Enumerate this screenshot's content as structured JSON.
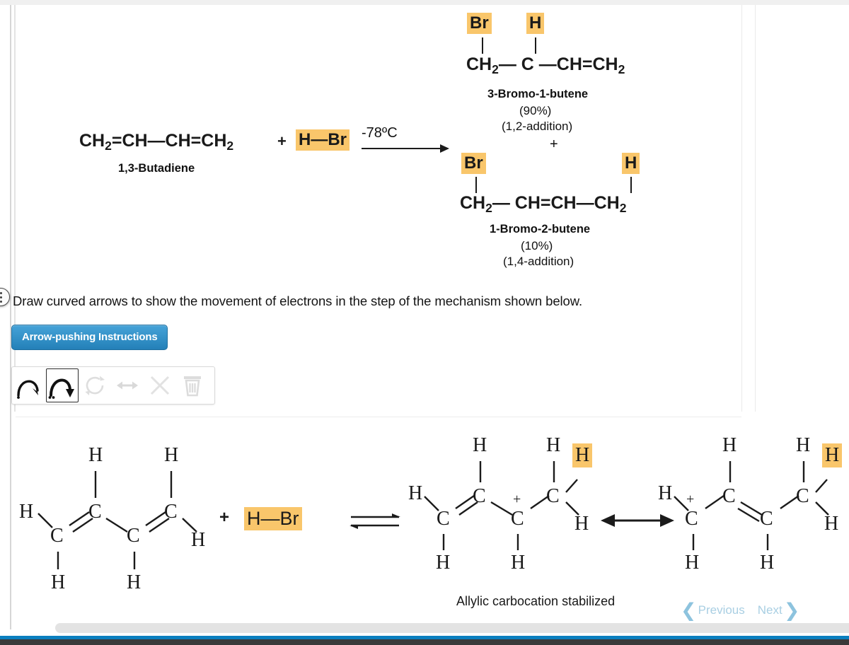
{
  "top_reaction": {
    "reactant": {
      "formula_parts": [
        "CH",
        "2",
        "=CH—CH=CH",
        "2"
      ],
      "plain": "CH2=CH—CH=CH2",
      "name": "1,3-Butadiene"
    },
    "plus_sign": "+",
    "reagent": {
      "label": "H—Br",
      "highlighted": true,
      "highlight_color": "#f9c66b"
    },
    "conditions": "-78ºC",
    "products": [
      {
        "top_substituent_left": "Br",
        "top_substituent_right": "H",
        "backbone": "CH2— C —CH=CH2",
        "name": "3-Bromo-1-butene",
        "yield": "(90%)",
        "addition_type": "(1,2-addition)"
      },
      {
        "top_substituent_left": "Br",
        "top_substituent_right": "H",
        "backbone": "CH2— CH=CH—CH2",
        "name": "1-Bromo-2-butene",
        "yield": "(10%)",
        "addition_type": "(1,4-addition)"
      }
    ],
    "products_joiner": "+"
  },
  "question": {
    "prompt": "Draw curved arrows to show the movement of electrons in the step of the mechanism shown below.",
    "instructions_button": "Arrow-pushing Instructions"
  },
  "toolbar": {
    "tools": [
      {
        "name": "single-barb-curved-arrow",
        "title": "Single-electron (fishhook) curved arrow",
        "selected": false,
        "disabled": false
      },
      {
        "name": "double-barb-curved-arrow",
        "title": "Two-electron curved arrow",
        "selected": true,
        "disabled": false
      },
      {
        "name": "rotate-icon",
        "title": "Rotate",
        "selected": false,
        "disabled": true
      },
      {
        "name": "resonance-arrow-icon",
        "title": "Resonance arrow",
        "selected": false,
        "disabled": true
      },
      {
        "name": "clear-x-icon",
        "title": "Clear",
        "selected": false,
        "disabled": true
      },
      {
        "name": "trash-icon",
        "title": "Delete",
        "selected": false,
        "disabled": true
      }
    ]
  },
  "mechanism": {
    "reactant_atoms": {
      "c1_h_left": "H",
      "c1_h_down": "H",
      "c2_h_up": "H",
      "c3_h_up": "H",
      "c3_h_down": "H",
      "c4_h_right": "H",
      "c_label": "C"
    },
    "plus_sign": "+",
    "reagent": {
      "label": "H—Br",
      "highlighted": true
    },
    "equilibrium_arrow": "⇌",
    "carbocation_1": {
      "charge": "+",
      "h_highlighted": "H",
      "c_label": "C",
      "h_label": "H"
    },
    "resonance_arrow": "↔",
    "carbocation_2": {
      "charge": "+",
      "h_highlighted": "H",
      "c_label": "C",
      "h_label": "H"
    },
    "caption": "Allylic carbocation stabilized"
  },
  "navigation": {
    "previous_label": "Previous",
    "next_label": "Next",
    "prev_chevron": "❮",
    "next_chevron": "❯"
  },
  "colors": {
    "highlight": "#f9c66b",
    "button_blue": "#2d8fc9",
    "nav_blue": "#a9cfe3",
    "bottom_bar_blue": "#0b7fbf",
    "bottom_bar_dark": "#3a3a3a",
    "text": "#141414"
  }
}
